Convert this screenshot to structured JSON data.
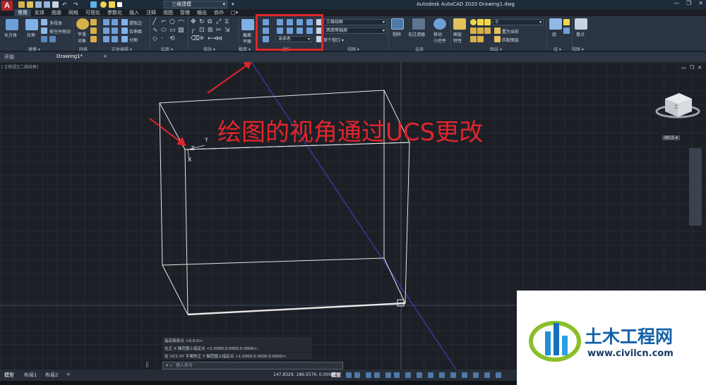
{
  "app": {
    "logo": "A",
    "workspace": "三维建模",
    "title": "Autodesk AutoCAD 2020    Drawing1.dwg",
    "window_buttons": [
      "—",
      "❐",
      "✕"
    ]
  },
  "ribbon_tabs": [
    "常用",
    "实体",
    "曲面",
    "网格",
    "可视化",
    "参数化",
    "插入",
    "注释",
    "视图",
    "管理",
    "输出",
    "协作",
    "□▾"
  ],
  "ribbon": {
    "model": {
      "box_label": "长方体",
      "extrude_label": "拉伸",
      "polysolid_label": "多段体",
      "presspull_label": "按住并拖动",
      "panel_label": "建模 ▾"
    },
    "mesh": {
      "smooth_label": "平滑\n对象",
      "panel_label": "网格"
    },
    "solid_edit": {
      "extract_label": "提取边",
      "extrude_face_label": "拉伸面",
      "separate_label": "分割",
      "panel_label": "实体编辑 ▾"
    },
    "draw": {
      "panel_label": "绘图 ▾"
    },
    "modify": {
      "panel_label": "修改 ▾"
    },
    "section": {
      "plane_label": "截面\n平面",
      "panel_label": "截面 ▾"
    },
    "coordinates": {
      "ucs_combo": "未命名",
      "panel_label": "坐标"
    },
    "view": {
      "visual_style": "三维线框",
      "view_combo": "西南等轴测",
      "viewport_label": "单个视口 ▾",
      "panel_label": "视图 ▾"
    },
    "selection": {
      "cull_label": "剔除",
      "no_filter_label": "无过滤器",
      "gizmo_label": "移动\n小控件",
      "panel_label": "选择"
    },
    "layers": {
      "layer_props_label": "图层\n特性",
      "layer_combo": "0",
      "set_current_label": "置为当前",
      "match_label": "匹配图层",
      "panel_label": "图层 ▾"
    },
    "group": {
      "group_label": "组",
      "panel_label": "组 ▾"
    },
    "base": {
      "base_label": "基点",
      "panel_label": "视图 ▾"
    }
  },
  "doc_tabs": {
    "start": "开始",
    "drawing": "Drawing1*",
    "add": "+"
  },
  "viewport": {
    "controls": "[-][俯视][二维线框]",
    "wcs": "WCS ▾",
    "ucs_axes": {
      "x": "X",
      "y": "Y",
      "z": "Z"
    },
    "window_controls": [
      "▭",
      "❐",
      "✕"
    ],
    "viewcube_face": "上"
  },
  "annotation": {
    "text": "绘图的视角通过UCS更改",
    "color": "#e2252c"
  },
  "command": {
    "history": [
      "指定新原点 <0,0,0>:",
      "在正 X 轴范围上指定点 <1.0000,0.0000,0.0000>:",
      "在 UCS XY 平面的正 Y 轴范围上指定点 <1.0000,0.0000,0.0000>:"
    ],
    "placeholder": "键入命令"
  },
  "statusbar": {
    "tabs": [
      "模型",
      "布局1",
      "布局2",
      "+"
    ],
    "coords": "147.8329, 186.5576, 0.0000",
    "model": "模型"
  },
  "watermark": {
    "name": "土木工程网",
    "url": "www.civilcn.com"
  },
  "colors": {
    "highlight_box": "#e0262b",
    "grid": "#2a2f37",
    "wireframe": "#e6e6e6",
    "axis_blue": "#3c3fae",
    "brand_blue": "#1560a8"
  }
}
